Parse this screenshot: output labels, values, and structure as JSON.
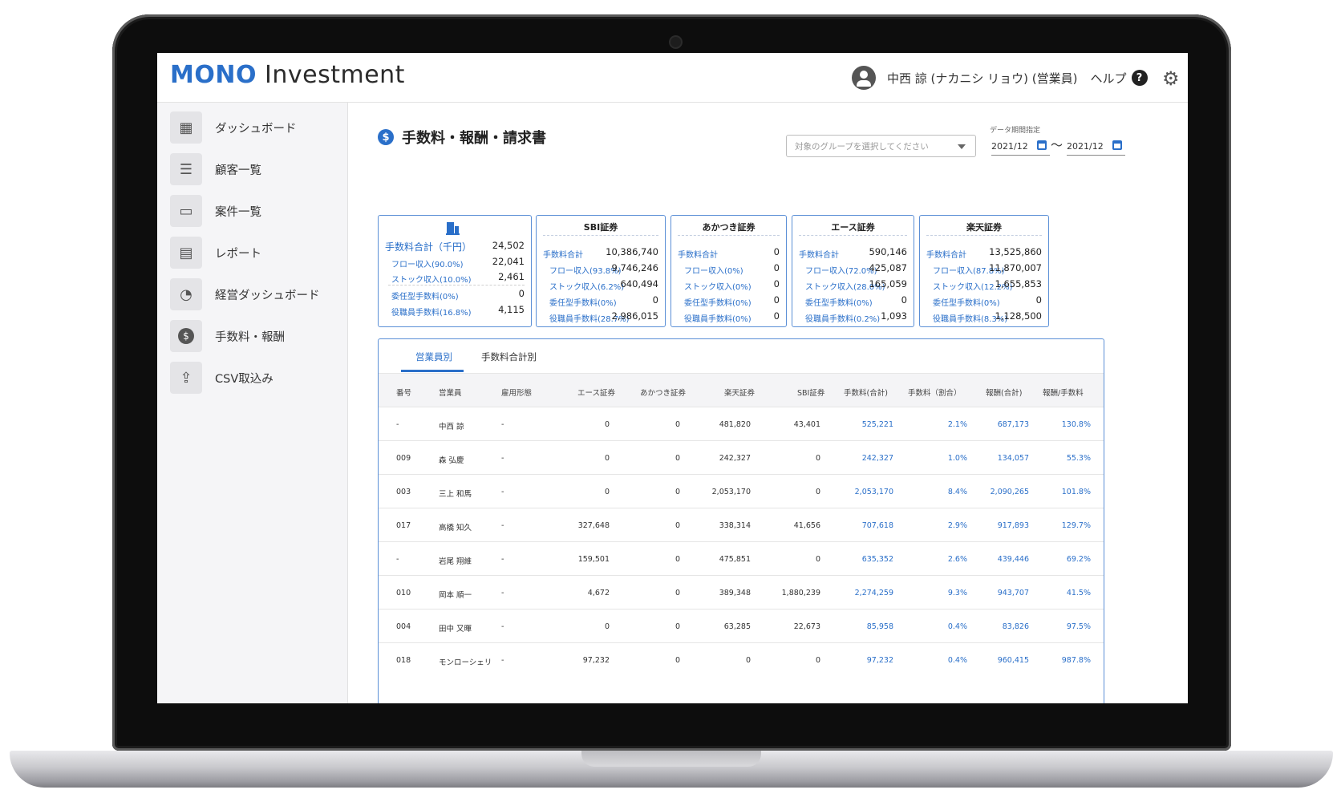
{
  "app": {
    "logo_mono": "MONO",
    "logo_rest": " Investment",
    "user_name": "中西 諒 (ナカニシ リョウ) (営業員)",
    "help_label": "ヘルプ",
    "help_glyph": "?"
  },
  "sidebar": {
    "items": [
      {
        "label": "ダッシュボード",
        "icon": "dashboard-icon"
      },
      {
        "label": "顧客一覧",
        "icon": "list-icon"
      },
      {
        "label": "案件一覧",
        "icon": "project-icon"
      },
      {
        "label": "レポート",
        "icon": "report-icon"
      },
      {
        "label": "経営ダッシュボード",
        "icon": "management-icon"
      },
      {
        "label": "手数料・報酬",
        "icon": "fee-icon"
      },
      {
        "label": "CSV取込み",
        "icon": "import-icon"
      }
    ]
  },
  "page": {
    "title": "手数料・報酬・請求書",
    "group_placeholder": "対象のグループを選択してください",
    "period_label": "データ期間指定",
    "date_from": "2021/12",
    "date_to": "2021/12",
    "tilde": "〜"
  },
  "summary": {
    "total_label": "手数料合計（千円）",
    "total": "24,502",
    "rows": [
      {
        "label": "フロー収入(90.0%)",
        "value": "22,041"
      },
      {
        "label": "ストック収入(10.0%)",
        "value": "2,461"
      },
      {
        "label": "委任型手数料(0%)",
        "value": "0"
      },
      {
        "label": "役職員手数料(16.8%)",
        "value": "4,115"
      }
    ]
  },
  "brokers": [
    {
      "name": "SBI証券",
      "rows": [
        {
          "label": "手数料合計",
          "value": "10,386,740"
        },
        {
          "label": "フロー収入(93.8%)",
          "value": "9,746,246"
        },
        {
          "label": "ストック収入(6.2%)",
          "value": "640,494"
        },
        {
          "label": "委任型手数料(0%)",
          "value": "0"
        },
        {
          "label": "役職員手数料(28.7%)",
          "value": "2,986,015"
        }
      ]
    },
    {
      "name": "あかつき証券",
      "rows": [
        {
          "label": "手数料合計",
          "value": "0"
        },
        {
          "label": "フロー収入(0%)",
          "value": "0"
        },
        {
          "label": "ストック収入(0%)",
          "value": "0"
        },
        {
          "label": "委任型手数料(0%)",
          "value": "0"
        },
        {
          "label": "役職員手数料(0%)",
          "value": "0"
        }
      ]
    },
    {
      "name": "エース証券",
      "rows": [
        {
          "label": "手数料合計",
          "value": "590,146"
        },
        {
          "label": "フロー収入(72.0%)",
          "value": "425,087"
        },
        {
          "label": "ストック収入(28.0%)",
          "value": "165,059"
        },
        {
          "label": "委任型手数料(0%)",
          "value": "0"
        },
        {
          "label": "役職員手数料(0.2%)",
          "value": "1,093"
        }
      ]
    },
    {
      "name": "楽天証券",
      "rows": [
        {
          "label": "手数料合計",
          "value": "13,525,860"
        },
        {
          "label": "フロー収入(87.8%)",
          "value": "11,870,007"
        },
        {
          "label": "ストック収入(12.2%)",
          "value": "1,655,853"
        },
        {
          "label": "委任型手数料(0%)",
          "value": "0"
        },
        {
          "label": "役職員手数料(8.3%)",
          "value": "1,128,500"
        }
      ]
    }
  ],
  "tabs": [
    "営業員別",
    "手数料合計別"
  ],
  "table": {
    "columns": [
      "番号",
      "営業員",
      "雇用形態",
      "エース証券",
      "あかつき証券",
      "楽天証券",
      "SBI証券",
      "手数料(合計)",
      "手数料（割合）",
      "報酬(合計)",
      "報酬/手数料"
    ],
    "rows": [
      [
        "-",
        "中西 諒",
        "-",
        "0",
        "0",
        "481,820",
        "43,401",
        "525,221",
        "2.1%",
        "687,173",
        "130.8%"
      ],
      [
        "009",
        "森 弘慶",
        "-",
        "0",
        "0",
        "242,327",
        "0",
        "242,327",
        "1.0%",
        "134,057",
        "55.3%"
      ],
      [
        "003",
        "三上 和馬",
        "-",
        "0",
        "0",
        "2,053,170",
        "0",
        "2,053,170",
        "8.4%",
        "2,090,265",
        "101.8%"
      ],
      [
        "017",
        "高橋 知久",
        "-",
        "327,648",
        "0",
        "338,314",
        "41,656",
        "707,618",
        "2.9%",
        "917,893",
        "129.7%"
      ],
      [
        "-",
        "岩尾 翔維",
        "-",
        "159,501",
        "0",
        "475,851",
        "0",
        "635,352",
        "2.6%",
        "439,446",
        "69.2%"
      ],
      [
        "010",
        "岡本 順一",
        "-",
        "4,672",
        "0",
        "389,348",
        "1,880,239",
        "2,274,259",
        "9.3%",
        "943,707",
        "41.5%"
      ],
      [
        "004",
        "田中 又暉",
        "-",
        "0",
        "0",
        "63,285",
        "22,673",
        "85,958",
        "0.4%",
        "83,826",
        "97.5%"
      ],
      [
        "018",
        "モンローシェリ",
        "-",
        "97,232",
        "0",
        "0",
        "0",
        "97,232",
        "0.4%",
        "960,415",
        "987.8%"
      ]
    ]
  },
  "colors": {
    "accent": "#2a6fc9",
    "card_border": "#5b8fd6"
  }
}
